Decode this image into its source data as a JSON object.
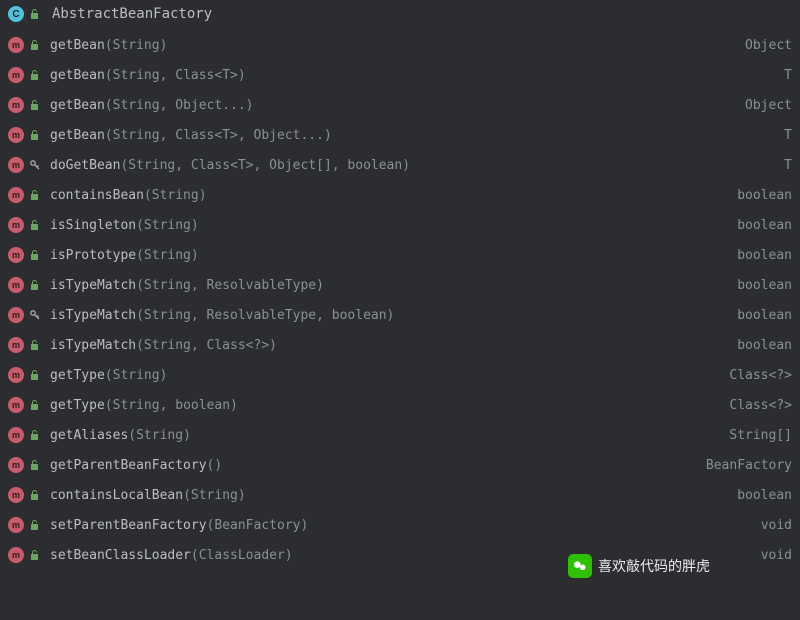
{
  "header": {
    "title": "AbstractBeanFactory",
    "class_icon_letter": "C"
  },
  "methods": [
    {
      "icon": "m",
      "access": "public",
      "name": "getBean",
      "sig": "(String)",
      "return": "Object"
    },
    {
      "icon": "m",
      "access": "public",
      "name": "getBean",
      "sig": "(String, Class<T>)",
      "return": "T"
    },
    {
      "icon": "m",
      "access": "public",
      "name": "getBean",
      "sig": "(String, Object...)",
      "return": "Object"
    },
    {
      "icon": "m",
      "access": "public",
      "name": "getBean",
      "sig": "(String, Class<T>, Object...)",
      "return": "T"
    },
    {
      "icon": "m",
      "access": "protected",
      "name": "doGetBean",
      "sig": "(String, Class<T>, Object[], boolean)",
      "return": "T"
    },
    {
      "icon": "m",
      "access": "public",
      "name": "containsBean",
      "sig": "(String)",
      "return": "boolean"
    },
    {
      "icon": "m",
      "access": "public",
      "name": "isSingleton",
      "sig": "(String)",
      "return": "boolean"
    },
    {
      "icon": "m",
      "access": "public",
      "name": "isPrototype",
      "sig": "(String)",
      "return": "boolean"
    },
    {
      "icon": "m",
      "access": "public",
      "name": "isTypeMatch",
      "sig": "(String, ResolvableType)",
      "return": "boolean"
    },
    {
      "icon": "m",
      "access": "protected",
      "name": "isTypeMatch",
      "sig": "(String, ResolvableType, boolean)",
      "return": "boolean"
    },
    {
      "icon": "m",
      "access": "public",
      "name": "isTypeMatch",
      "sig": "(String, Class<?>)",
      "return": "boolean"
    },
    {
      "icon": "m",
      "access": "public",
      "name": "getType",
      "sig": "(String)",
      "return": "Class<?>"
    },
    {
      "icon": "m",
      "access": "public",
      "name": "getType",
      "sig": "(String, boolean)",
      "return": "Class<?>"
    },
    {
      "icon": "m",
      "access": "public",
      "name": "getAliases",
      "sig": "(String)",
      "return": "String[]"
    },
    {
      "icon": "m",
      "access": "public",
      "name": "getParentBeanFactory",
      "sig": "()",
      "return": "BeanFactory"
    },
    {
      "icon": "m",
      "access": "public",
      "name": "containsLocalBean",
      "sig": "(String)",
      "return": "boolean"
    },
    {
      "icon": "m",
      "access": "public",
      "name": "setParentBeanFactory",
      "sig": "(BeanFactory)",
      "return": "void"
    },
    {
      "icon": "m",
      "access": "public",
      "name": "setBeanClassLoader",
      "sig": "(ClassLoader)",
      "return": "void"
    }
  ],
  "attribution": {
    "text": "喜欢敲代码的胖虎"
  }
}
